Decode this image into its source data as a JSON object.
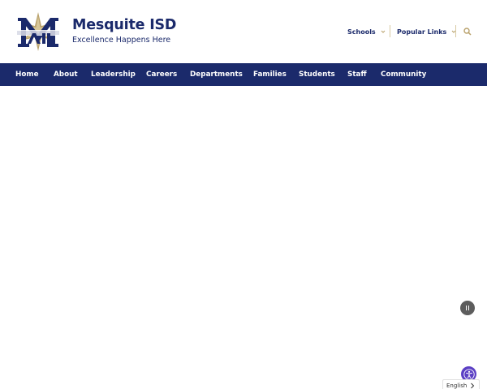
{
  "site": {
    "title": "Mesquite ISD",
    "tagline": "Excellence Happens Here",
    "logo_icon": "mesquite-m-star-logo",
    "colors": {
      "navy": "#1b2a6b",
      "gold": "#b9a16b",
      "accent_purple": "#5b3fc4"
    }
  },
  "utility": {
    "schools_label": "Schools",
    "popular_links_label": "Popular Links",
    "search_icon": "search-icon"
  },
  "nav": {
    "items": [
      {
        "label": "Home"
      },
      {
        "label": "About"
      },
      {
        "label": "Leadership"
      },
      {
        "label": "Careers"
      },
      {
        "label": "Departments"
      },
      {
        "label": "Families"
      },
      {
        "label": "Students"
      },
      {
        "label": "Staff"
      },
      {
        "label": "Community"
      }
    ]
  },
  "controls": {
    "pause_icon": "pause-icon",
    "accessibility_icon": "accessibility-icon"
  },
  "language": {
    "selected": "English"
  }
}
